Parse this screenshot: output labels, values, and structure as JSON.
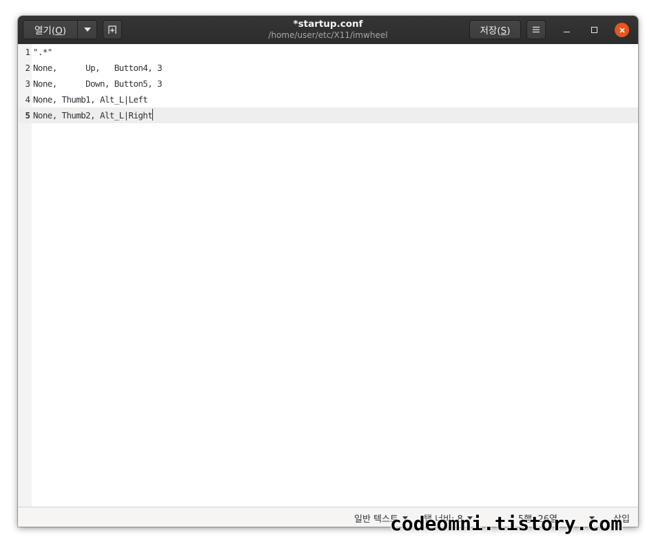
{
  "header": {
    "open_button": {
      "label_prefix": "열기(",
      "mnemonic": "O",
      "label_suffix": ")"
    },
    "title": "*startup.conf",
    "subtitle": "/home/user/etc/X11/imwheel",
    "save_button": {
      "label_prefix": "저장(",
      "mnemonic": "S",
      "label_suffix": ")"
    },
    "icons": {
      "open_menu": "chevron-down-icon",
      "new_tab": "new-tab-icon",
      "menu": "hamburger-icon",
      "minimize": "minimize-icon",
      "maximize": "maximize-icon",
      "close": "close-icon"
    },
    "close_color": "#e95420"
  },
  "editor": {
    "current_line": 5,
    "lines": [
      {
        "number": "1",
        "text": "\".*\""
      },
      {
        "number": "2",
        "text": "None,      Up,   Button4, 3"
      },
      {
        "number": "3",
        "text": "None,      Down, Button5, 3"
      },
      {
        "number": "4",
        "text": "None, Thumb1, Alt_L|Left"
      },
      {
        "number": "5",
        "text": "None, Thumb2, Alt_L|Right"
      }
    ]
  },
  "statusbar": {
    "language": "일반 텍스트",
    "tab_width": "탭 너비: 8",
    "position": "5행, 26열",
    "mode": "삽입"
  },
  "watermark": "codeomni.tistory.com"
}
